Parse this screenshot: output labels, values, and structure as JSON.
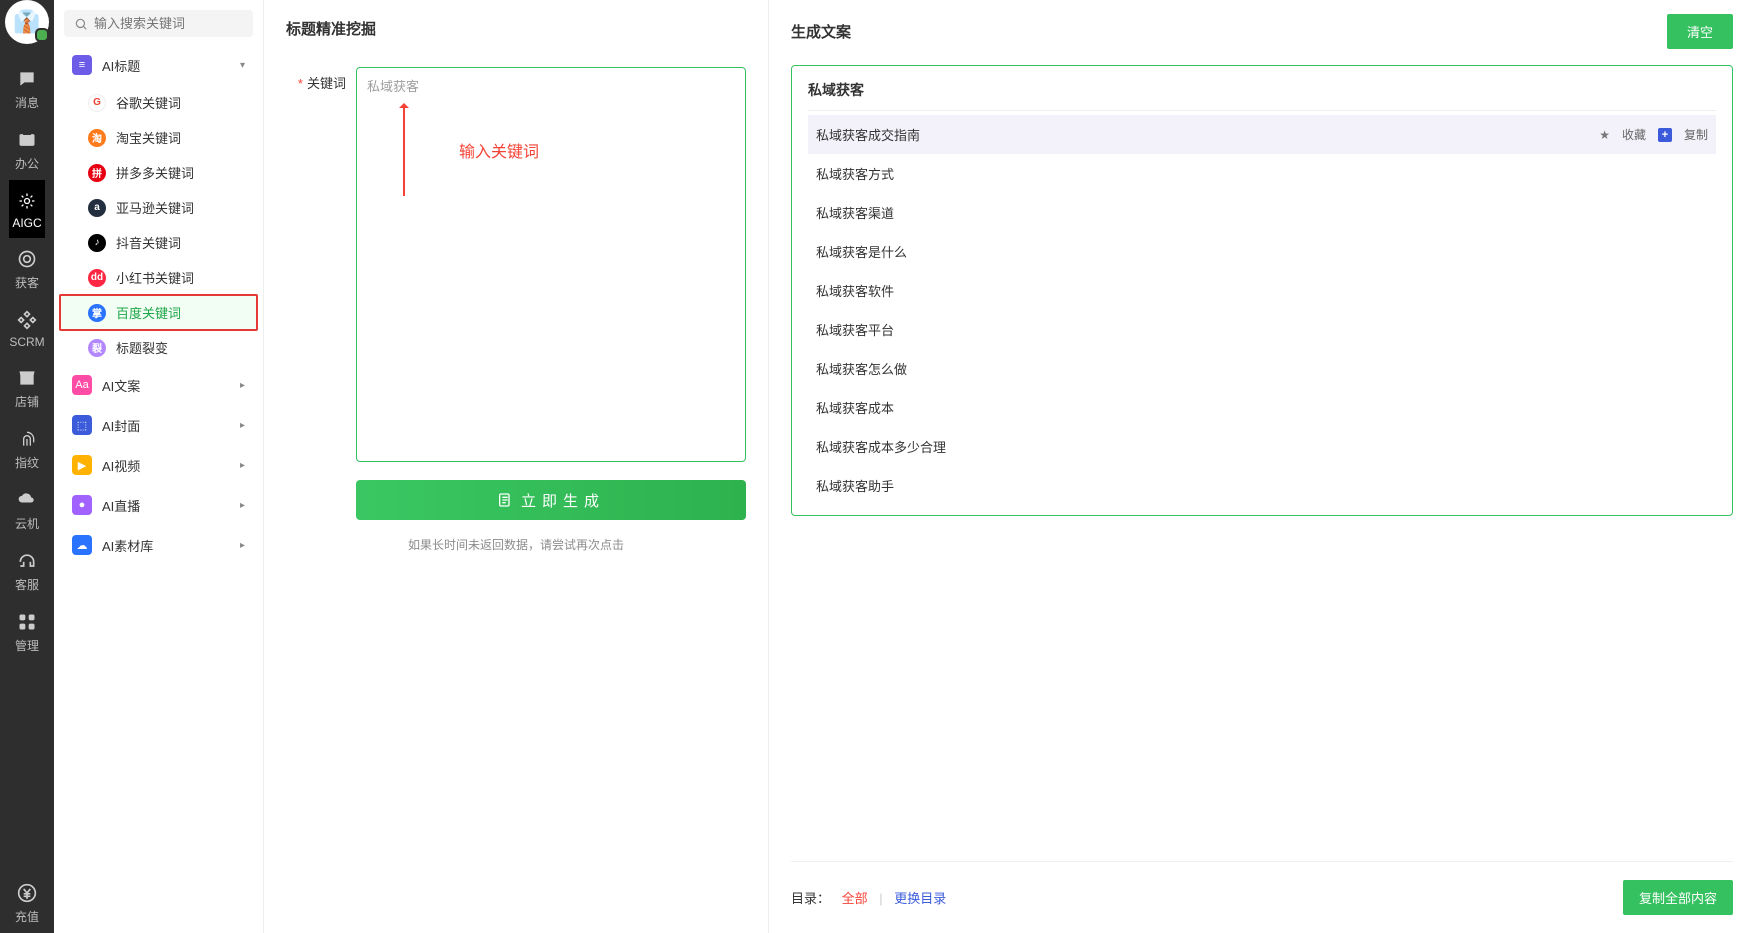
{
  "rail": {
    "items": [
      {
        "label": "消息",
        "icon": "chat"
      },
      {
        "label": "办公",
        "icon": "badge"
      },
      {
        "label": "AIGC",
        "icon": "brain",
        "active": true
      },
      {
        "label": "获客",
        "icon": "target"
      },
      {
        "label": "SCRM",
        "icon": "scrm"
      },
      {
        "label": "店铺",
        "icon": "shop"
      },
      {
        "label": "指纹",
        "icon": "fingerprint"
      },
      {
        "label": "云机",
        "icon": "cloud"
      },
      {
        "label": "客服",
        "icon": "headset"
      },
      {
        "label": "管理",
        "icon": "grid"
      }
    ],
    "bottom": {
      "label": "充值",
      "icon": "yen"
    }
  },
  "secondary": {
    "search_placeholder": "输入搜索关键词",
    "group_label": "AI标题",
    "subs": [
      {
        "label": "谷歌关键词",
        "color": "#fff",
        "fg": "#ea4335",
        "txt": "G",
        "ring": true
      },
      {
        "label": "淘宝关键词",
        "color": "#ff7a1a",
        "txt": "淘"
      },
      {
        "label": "拼多多关键词",
        "color": "#e60012",
        "txt": "拼"
      },
      {
        "label": "亚马逊关键词",
        "color": "#232f3e",
        "txt": "a"
      },
      {
        "label": "抖音关键词",
        "color": "#000",
        "txt": "♪"
      },
      {
        "label": "小红书关键词",
        "color": "#ff2741",
        "txt": "dd"
      },
      {
        "label": "百度关键词",
        "color": "#2a73ff",
        "txt": "掌",
        "selected": true
      },
      {
        "label": "标题裂变",
        "color": "#b388ff",
        "txt": "裂"
      }
    ],
    "groups2": [
      {
        "label": "AI文案",
        "color": "#ff4da6",
        "txt": "Aa"
      },
      {
        "label": "AI封面",
        "color": "#3b5bdb",
        "txt": "⬚"
      },
      {
        "label": "AI视频",
        "color": "#ffb300",
        "txt": "▶"
      },
      {
        "label": "AI直播",
        "color": "#a162ff",
        "txt": "●"
      },
      {
        "label": "AI素材库",
        "color": "#2a73ff",
        "txt": "☁"
      }
    ]
  },
  "center": {
    "title": "标题精准挖掘",
    "kw_label": "关键词",
    "kw_value": "私域获客",
    "anno": "输入关键词",
    "gen_label": "立即生成",
    "retry": "如果长时间未返回数据，请尝试再次点击"
  },
  "right": {
    "title": "生成文案",
    "clear": "清空",
    "card_title": "私域获客",
    "rows": [
      "私域获客成交指南",
      "私域获客方式",
      "私域获客渠道",
      "私域获客是什么",
      "私域获客软件",
      "私域获客平台",
      "私域获客怎么做",
      "私域获客成本",
      "私域获客成本多少合理",
      "私域获客助手"
    ],
    "fav": "收藏",
    "copy": "复制",
    "bottom": {
      "label": "目录：",
      "all": "全部",
      "swap": "更换目录",
      "copyall": "复制全部内容"
    }
  }
}
